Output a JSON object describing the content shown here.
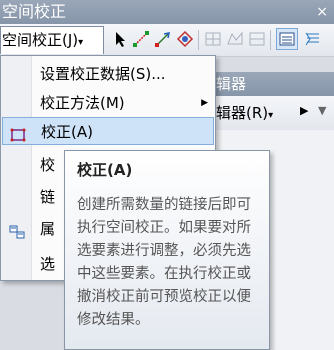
{
  "window": {
    "title": "空间校正",
    "close_glyph": "×"
  },
  "toolbar": {
    "menu_label": "空间校正(J)",
    "menu_arrow": "▾"
  },
  "background_window": {
    "title": "辑器",
    "menu_label": "辑器(R)",
    "menu_arrow": "▾"
  },
  "menu": {
    "items": [
      {
        "label": "设置校正数据(S)...",
        "icon": "",
        "submenu": false
      },
      {
        "label": "校正方法(M)",
        "icon": "",
        "submenu": true
      },
      {
        "label": "校正(A)",
        "icon": "adjust-icon",
        "submenu": false,
        "highlighted": true
      },
      {
        "label": "校",
        "icon": "",
        "submenu": false
      },
      {
        "label": "链",
        "icon": "",
        "submenu": false
      },
      {
        "label": "属",
        "icon": "attribute-transfer-icon",
        "submenu": false
      },
      {
        "label": "选",
        "icon": "",
        "submenu": false
      }
    ]
  },
  "tooltip": {
    "title": "校正(A)",
    "body": "创建所需数量的链接后即可执行空间校正。如果要对所选要素进行调整，必须先选中这些要素。在执行校正或撤消校正前可预览校正以便修改结果。"
  }
}
